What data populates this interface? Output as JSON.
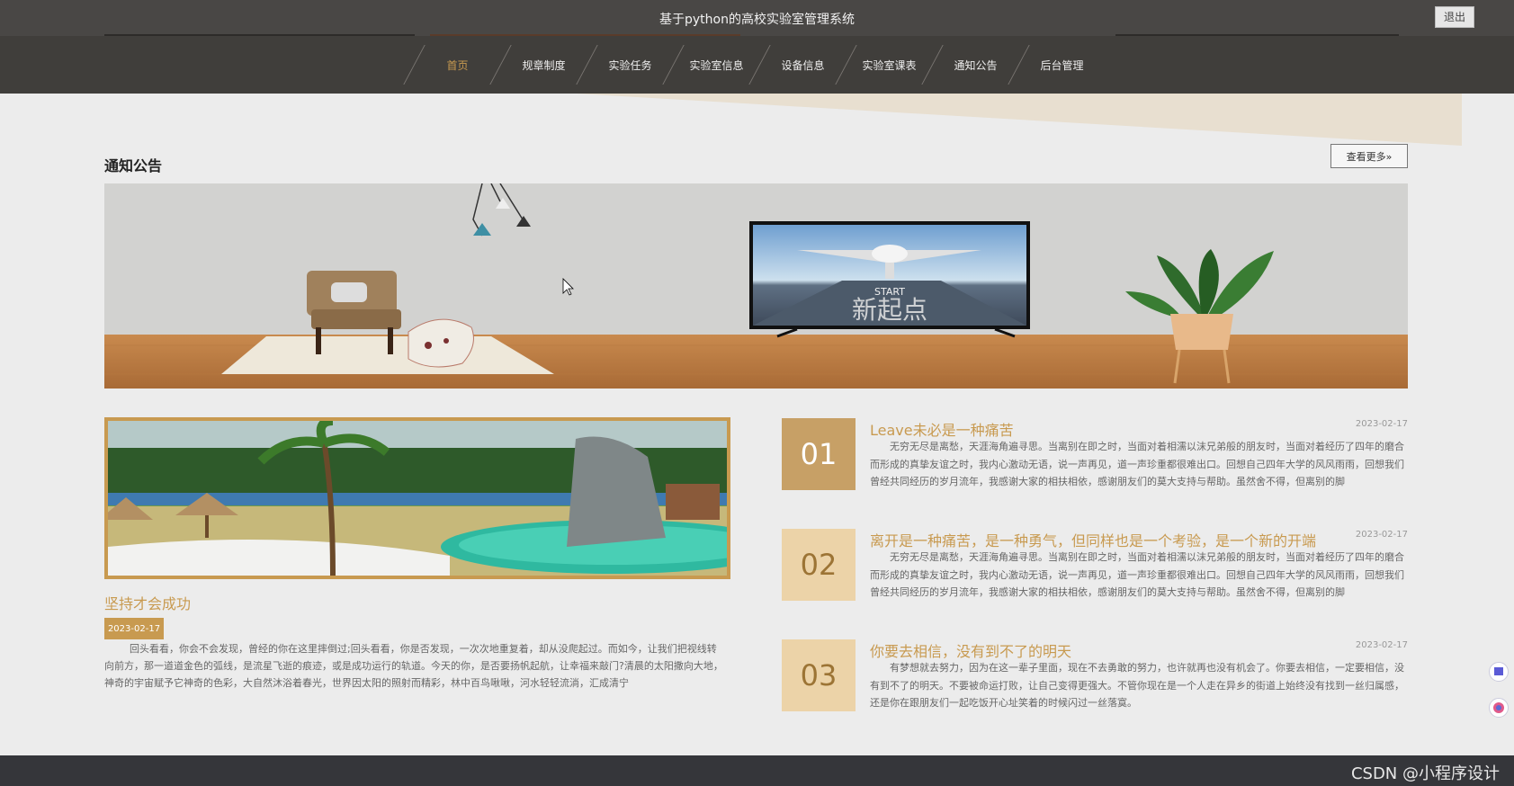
{
  "header": {
    "title": "基于python的高校实验室管理系统",
    "logout_label": "退出"
  },
  "nav": {
    "items": [
      {
        "label": "首页",
        "active": true
      },
      {
        "label": "规章制度"
      },
      {
        "label": "实验任务"
      },
      {
        "label": "实验室信息"
      },
      {
        "label": "设备信息"
      },
      {
        "label": "实验室课表"
      },
      {
        "label": "通知公告"
      },
      {
        "label": "后台管理"
      }
    ]
  },
  "section": {
    "title": "通知公告",
    "more_label": "查看更多»"
  },
  "banner": {
    "tv_caption_en": "START",
    "tv_caption_cn": "新起点"
  },
  "featured": {
    "title": "坚持才会成功",
    "date": "2023-02-17",
    "body": "回头看看，你会不会发现，曾经的你在这里摔倒过;回头看看，你是否发现，一次次地重复着，却从没爬起过。而如今，让我们把视线转向前方，那一道道金色的弧线，是流星飞逝的痕迹，或是成功运行的轨道。今天的你，是否要扬帆起航，让幸福来敲门?清晨的太阳撒向大地，神奇的宇宙赋予它神奇的色彩，大自然沐浴着春光，世界因太阳的照射而精彩，林中百鸟啾啾，河水轻轻流淌，汇成清宁"
  },
  "notices": [
    {
      "number": "01",
      "title": "Leave未必是一种痛苦",
      "date": "2023-02-17",
      "body": "无穷无尽是离愁，天涯海角遍寻思。当离别在即之时，当面对着相濡以沫兄弟般的朋友时，当面对着经历了四年的磨合而形成的真挚友谊之时，我内心激动无语，说一声再见，道一声珍重都很难出口。回想自己四年大学的风风雨雨，回想我们曾经共同经历的岁月流年，我感谢大家的相扶相依，感谢朋友们的莫大支持与帮助。虽然舍不得，但离别的脚"
    },
    {
      "number": "02",
      "title": "离开是一种痛苦，是一种勇气，但同样也是一个考验，是一个新的开端",
      "date": "2023-02-17",
      "body": "无穷无尽是离愁，天涯海角遍寻思。当离别在即之时，当面对着相濡以沫兄弟般的朋友时，当面对着经历了四年的磨合而形成的真挚友谊之时，我内心激动无语，说一声再见，道一声珍重都很难出口。回想自己四年大学的风风雨雨，回想我们曾经共同经历的岁月流年，我感谢大家的相扶相依，感谢朋友们的莫大支持与帮助。虽然舍不得，但离别的脚"
    },
    {
      "number": "03",
      "title": "你要去相信，没有到不了的明天",
      "date": "2023-02-17",
      "body": "有梦想就去努力，因为在这一辈子里面，现在不去勇敢的努力，也许就再也没有机会了。你要去相信，一定要相信，没有到不了的明天。不要被命运打败，让自己变得更强大。不管你现在是一个人走在异乡的街道上始终没有找到一丝归属感，还是你在跟朋友们一起吃饭开心址笑着的时候闪过一丝落寞。"
    }
  ],
  "footer": {
    "watermark": "CSDN @小程序设计"
  },
  "colors": {
    "accent": "#c89a50",
    "topbar": "#494745",
    "navbar": "#403e3b",
    "page_bg": "#ececec"
  }
}
